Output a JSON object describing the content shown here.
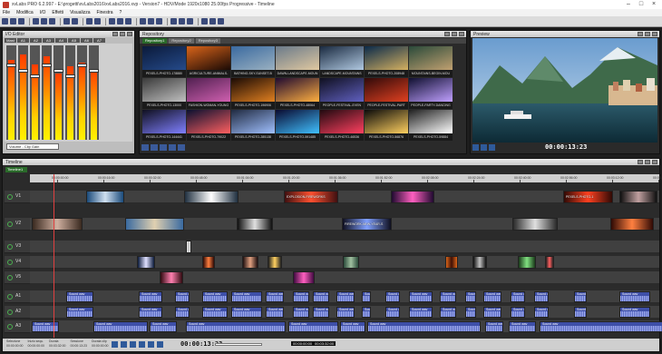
{
  "window": {
    "title": "xvLabs PRO 6.2.997 - E:\\progetti\\xvLabs2016\\xvLabs2016.xvp - Version7 - HDV/Mode 1920x1080 25.00fps Progressive - Timeline",
    "minimize": "–",
    "maximize": "□",
    "close": "×"
  },
  "menu": [
    "File",
    "Modifica",
    "I/O",
    "Effetti",
    "Visualizza",
    "Finestra",
    "?"
  ],
  "mixer": {
    "title": "I/O Editor",
    "channels": [
      "Mast",
      "A1",
      "A2",
      "A3",
      "A4",
      "A5",
      "A6",
      "A7"
    ],
    "levels": [
      0.85,
      0.9,
      0.8,
      0.88,
      0.7,
      0.78,
      0.82,
      0.75
    ],
    "select": "Volume - Clip Gain"
  },
  "repository": {
    "title": "Repository",
    "tabs": [
      "Repository1",
      "Repository2",
      "Repository3"
    ],
    "thumbs": [
      {
        "label": "PEXELS-PHOTO-178880",
        "c1": "#0b1a3a",
        "c2": "#254a8a"
      },
      {
        "label": "AGRICULTURE-ANIMALS-",
        "c1": "#d9641a",
        "c2": "#1a0a05"
      },
      {
        "label": "BATHING-SKY-SUNSET-B",
        "c1": "#3a6aa0",
        "c2": "#9ab0c0"
      },
      {
        "label": "DAWN-LANDSCAPE-MOUN",
        "c1": "#6a7a8a",
        "c2": "#e0c8a0"
      },
      {
        "label": "LANDSCAPE-MOUNTAINS",
        "c1": "#1a2a40",
        "c2": "#b0c8e0"
      },
      {
        "label": "PEXELS-PHOTO-208948",
        "c1": "#0a2a4a",
        "c2": "#d4b060"
      },
      {
        "label": "MOUNTAINS-BEGIN-MOU",
        "c1": "#2a4a3a",
        "c2": "#c0a070"
      },
      {
        "label": "PEXELS-PHOTO-13000",
        "c1": "#3a3a3a",
        "c2": "#c0c0c0"
      },
      {
        "label": "FASHION-WOMAN-YOUNG",
        "c1": "#502050",
        "c2": "#d060b0"
      },
      {
        "label": "PEXELS-PHOTO-196906",
        "c1": "#1a0a05",
        "c2": "#e08020"
      },
      {
        "label": "PEXELS-PHOTO-48064",
        "c1": "#200a30",
        "c2": "#ffb040"
      },
      {
        "label": "PEOPLE-FESTIVAL-EVEN",
        "c1": "#101020",
        "c2": "#6060c0"
      },
      {
        "label": "PEOPLE-FESTIVAL-PART",
        "c1": "#300a0a",
        "c2": "#e04020"
      },
      {
        "label": "PEOPLE-PARTY-DANCING",
        "c1": "#101030",
        "c2": "#c0a0ff"
      },
      {
        "label": "PEXELS-PHOTO-144441",
        "c1": "#101020",
        "c2": "#8080ff"
      },
      {
        "label": "PEXELS-PHOTO-79022",
        "c1": "#0a1030",
        "c2": "#ff6060"
      },
      {
        "label": "PEXELS-PHOTO-285138",
        "c1": "#202a40",
        "c2": "#a0c0ff"
      },
      {
        "label": "PEXELS-PHOTO-591485",
        "c1": "#0a0a30",
        "c2": "#40c0ff"
      },
      {
        "label": "PEXELS-PHOTO-46536",
        "c1": "#200a10",
        "c2": "#ff4060"
      },
      {
        "label": "PEXELS-PHOTO-56876",
        "c1": "#0a0a0a",
        "c2": "#ffd060"
      },
      {
        "label": "PEXELS-PHOTO-59884",
        "c1": "#202020",
        "c2": "#ffffff"
      }
    ]
  },
  "preview": {
    "title": "Preview",
    "timecode": "00:00:13:23"
  },
  "timeline": {
    "title": "Timeline",
    "tool_label": "Timeline1",
    "ruler": [
      "00:00:00:00",
      "00:00:16:00",
      "00:00:32:00",
      "00:00:48:00",
      "00:01:04:00",
      "00:01:20:00",
      "00:01:36:00",
      "00:01:52:00",
      "00:02:08:00",
      "00:02:24:00",
      "00:02:40:00",
      "00:02:56:00",
      "00:03:12:00",
      "00:03:28:00"
    ],
    "tracks": [
      "V1",
      "V2",
      "V3",
      "V4",
      "V5",
      "A1",
      "A2",
      "A3"
    ],
    "clip_titles": [
      "EXPLOSION-FIREWORKS",
      "FIREWORK-NEW-YEAR-S",
      "PEXELS-PHOTO-1"
    ],
    "audio_label": "Sound wav",
    "timecode": "00:00:13:23",
    "tc_in": "00:00:00:00",
    "tc_out": "00:03:32:00",
    "info": [
      {
        "k": "Selezione",
        "v": "00:00:00:00"
      },
      {
        "k": "Inizio sequ.",
        "v": "00:00:00:00"
      },
      {
        "k": "Durata",
        "v": "00:03:32:00"
      },
      {
        "k": "Sessione",
        "v": "00:00:13:23"
      },
      {
        "k": "Durata clip",
        "v": "00:00:00:00"
      }
    ]
  }
}
